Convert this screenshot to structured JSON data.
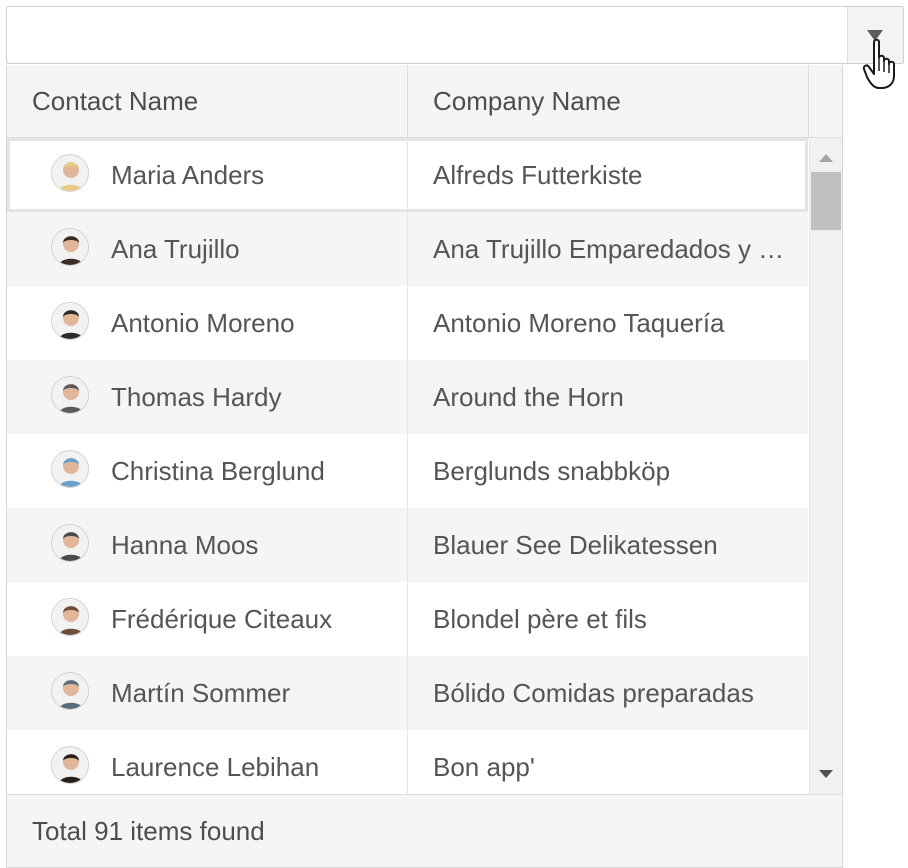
{
  "combobox": {
    "value": "",
    "dropdown_icon": "triangle-down-icon",
    "cursor_icon": "hand-pointer-icon"
  },
  "grid": {
    "columns": [
      "Contact Name",
      "Company Name"
    ],
    "rows": [
      {
        "contact": "Maria Anders",
        "company": "Alfreds Futterkiste",
        "avatar_color": "#e8c98a",
        "selected": true
      },
      {
        "contact": "Ana Trujillo",
        "company": "Ana Trujillo Emparedados y helados",
        "avatar_color": "#3b2a22"
      },
      {
        "contact": "Antonio Moreno",
        "company": "Antonio Moreno Taquería",
        "avatar_color": "#2f2a28"
      },
      {
        "contact": "Thomas Hardy",
        "company": "Around the Horn",
        "avatar_color": "#5b5b5b"
      },
      {
        "contact": "Christina Berglund",
        "company": "Berglunds snabbköp",
        "avatar_color": "#6aa0c8"
      },
      {
        "contact": "Hanna Moos",
        "company": "Blauer See Delikatessen",
        "avatar_color": "#4a4a4a"
      },
      {
        "contact": "Frédérique Citeaux",
        "company": "Blondel père et fils",
        "avatar_color": "#6e4b3a"
      },
      {
        "contact": "Martín Sommer",
        "company": "Bólido Comidas preparadas",
        "avatar_color": "#5a6b7a"
      },
      {
        "contact": "Laurence Lebihan",
        "company": "Bon app'",
        "avatar_color": "#2b1f1a"
      }
    ],
    "scroll_up_icon": "scroll-up-arrow-icon",
    "scroll_down_icon": "scroll-down-arrow-icon"
  },
  "footer": {
    "text": "Total 91 items found"
  }
}
